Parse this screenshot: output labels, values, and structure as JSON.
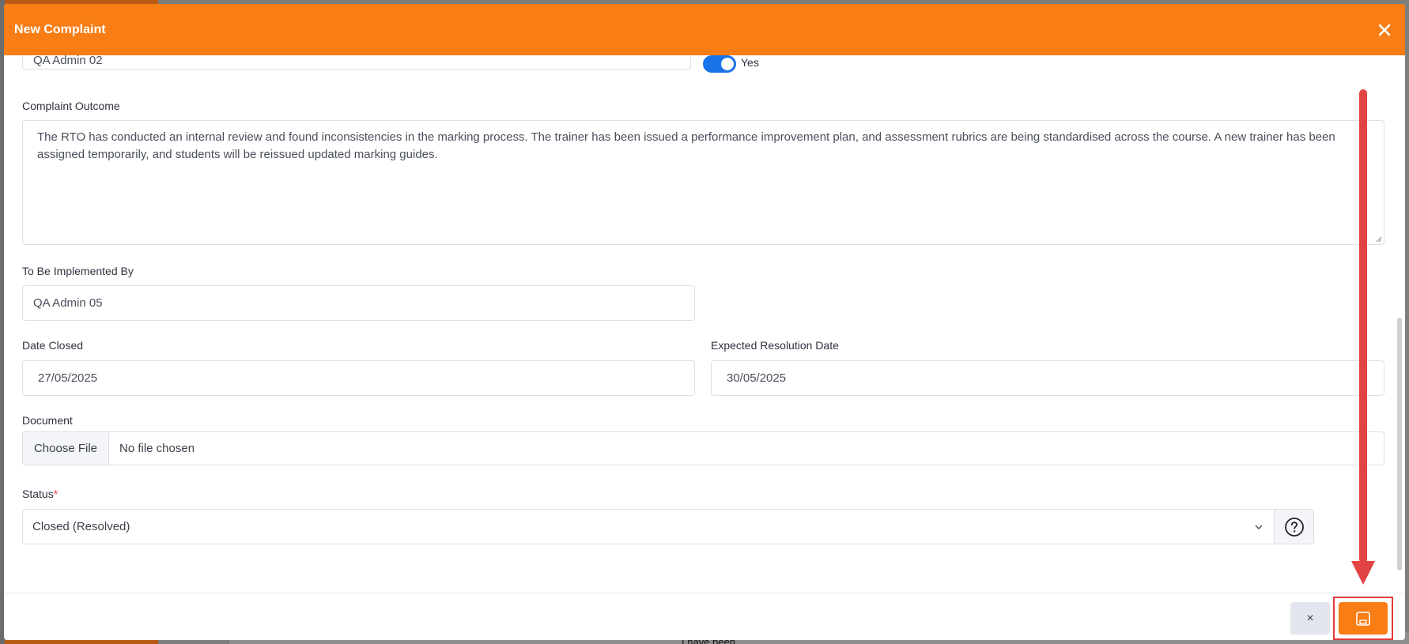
{
  "modal": {
    "title": "New Complaint",
    "fields": {
      "top_value": "QA Admin 02",
      "toggle_label": "Yes",
      "complaint_outcome_label": "Complaint Outcome",
      "complaint_outcome_value": "The RTO has conducted an internal review and found inconsistencies in the marking process. The trainer has been issued a performance improvement plan, and assessment rubrics are being standardised across the course. A new trainer has been assigned temporarily, and students will be reissued updated marking guides.",
      "implemented_by_label": "To Be Implemented By",
      "implemented_by_value": "QA Admin 05",
      "date_closed_label": "Date Closed",
      "date_closed_value": "27/05/2025",
      "expected_resolution_label": "Expected Resolution Date",
      "expected_resolution_value": "30/05/2025",
      "document_label": "Document",
      "choose_file_label": "Choose File",
      "no_file_text": "No file chosen",
      "status_label": "Status",
      "status_required_mark": "*",
      "status_value": "Closed (Resolved)"
    },
    "footer": {
      "cancel_label": "×"
    }
  },
  "background": {
    "table_text": "I have been"
  },
  "icons": {
    "close": "close-icon",
    "chevron": "chevron-down-icon",
    "help": "question-circle-icon",
    "save": "save-icon"
  },
  "colors": {
    "header": "#f97d15",
    "toggle_on": "#1a73e8",
    "annotation": "#e24444",
    "required": "#e23b3b"
  }
}
